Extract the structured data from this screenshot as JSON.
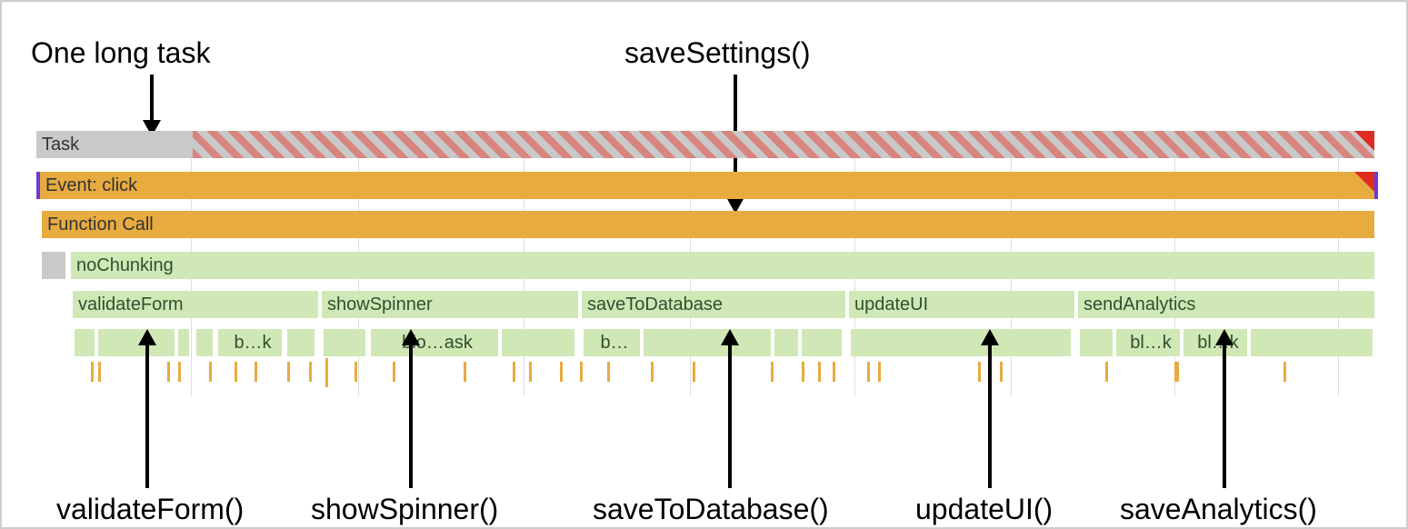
{
  "labels": {
    "top_left": "One long task",
    "top_right": "saveSettings()",
    "bottom": {
      "validateForm": "validateForm()",
      "showSpinner": "showSpinner()",
      "saveToDatabase": "saveToDatabase()",
      "updateUI": "updateUI()",
      "saveAnalytics": "saveAnalytics()"
    }
  },
  "rows": {
    "task": "Task",
    "event": "Event: click",
    "function_call": "Function Call",
    "no_chunking": "noChunking",
    "children": {
      "validateForm": "validateForm",
      "showSpinner": "showSpinner",
      "saveToDatabase": "saveToDatabase",
      "updateUI": "updateUI",
      "sendAnalytics": "sendAnalytics"
    },
    "subtasks": {
      "b1": "b…k",
      "b2": "blo…ask",
      "b3": "b…",
      "b4": "bl…k",
      "b5": "bl…k"
    }
  }
}
